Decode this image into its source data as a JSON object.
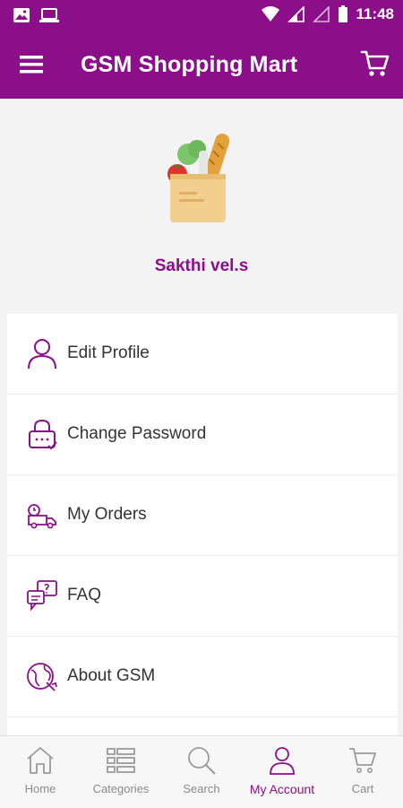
{
  "status_bar": {
    "time": "11:48",
    "left_icons": [
      "image-icon",
      "laptop-icon"
    ],
    "right_icons": [
      "wifi-icon",
      "signal-icon",
      "signal-empty-icon",
      "battery-icon"
    ]
  },
  "app_bar": {
    "title": "GSM Shopping Mart",
    "menu_icon": "hamburger-menu-icon",
    "cart_icon": "cart-icon"
  },
  "profile": {
    "image_icon": "grocery-bag-icon",
    "name": "Sakthi vel.s"
  },
  "menu": {
    "items": [
      {
        "label": "Edit Profile",
        "icon": "user-icon"
      },
      {
        "label": "Change Password",
        "icon": "lock-icon"
      },
      {
        "label": "My Orders",
        "icon": "delivery-truck-icon"
      },
      {
        "label": "FAQ",
        "icon": "faq-icon"
      },
      {
        "label": "About GSM",
        "icon": "globe-icon"
      }
    ]
  },
  "bottom_nav": {
    "items": [
      {
        "label": "Home",
        "icon": "home-icon"
      },
      {
        "label": "Categories",
        "icon": "list-icon"
      },
      {
        "label": "Search",
        "icon": "search-icon"
      },
      {
        "label": "My Account",
        "icon": "user-icon"
      },
      {
        "label": "Cart",
        "icon": "cart-icon"
      }
    ],
    "active": "My Account"
  },
  "colors": {
    "primary": "#8a0f88",
    "background": "#f3f3f3",
    "nav_inactive": "#8a8a8a"
  }
}
